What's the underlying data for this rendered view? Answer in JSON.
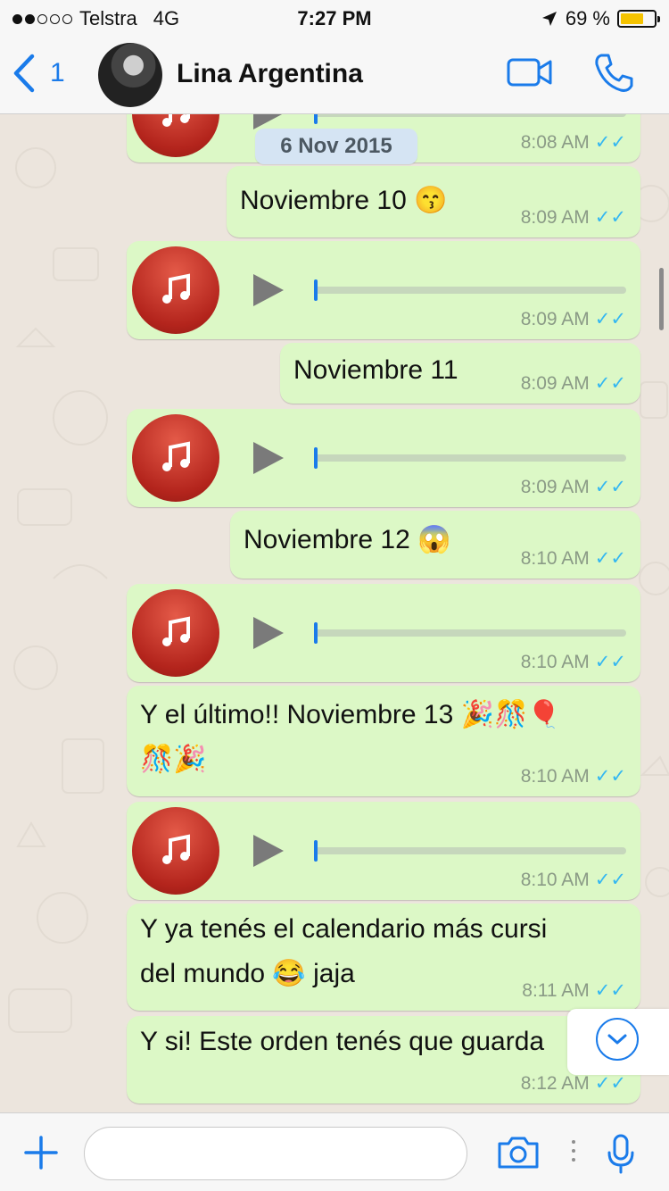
{
  "status_bar": {
    "carrier": "Telstra",
    "network": "4G",
    "time": "7:27 PM",
    "battery_percent_label": "69 %",
    "battery_level": 0.69,
    "signal_bars_filled": 2,
    "signal_bars_total": 5
  },
  "header": {
    "back_count": "1",
    "contact_name": "Lina Argentina",
    "icons": [
      "back-chevron-icon",
      "video-call-icon",
      "phone-call-icon"
    ]
  },
  "chat": {
    "date_separator": "6 Nov 2015",
    "messages": [
      {
        "type": "audio",
        "time": "8:08 AM"
      },
      {
        "type": "text",
        "text": "Noviembre 10 😙",
        "time": "8:09 AM"
      },
      {
        "type": "audio",
        "time": "8:09 AM"
      },
      {
        "type": "text",
        "text": "Noviembre 11",
        "time": "8:09 AM"
      },
      {
        "type": "audio",
        "time": "8:09 AM"
      },
      {
        "type": "text",
        "text": "Noviembre 12 😱",
        "time": "8:10 AM"
      },
      {
        "type": "audio",
        "time": "8:10 AM"
      },
      {
        "type": "text",
        "text": "Y el último!! Noviembre 13 🎉🎊🎈",
        "text2": "🎊🎉",
        "time": "8:10 AM"
      },
      {
        "type": "audio",
        "time": "8:10 AM"
      },
      {
        "type": "text",
        "text": "Y ya tenés el calendario más cursi",
        "text2": "del mundo 😂  jaja",
        "time": "8:11 AM"
      },
      {
        "type": "text",
        "text": "Y si! Este orden tenés que guarda",
        "time": "8:12 AM"
      }
    ],
    "read_receipt": "✓✓"
  },
  "input_bar": {
    "message_value": "",
    "icons": [
      "plus-icon",
      "camera-icon",
      "microphone-icon"
    ]
  },
  "colors": {
    "accent": "#1a7bea",
    "outgoing_bubble": "#dcf8c6",
    "chat_background": "#ece5dd",
    "read_ticks": "#34b7f1",
    "audio_icon": "#c0392b"
  }
}
